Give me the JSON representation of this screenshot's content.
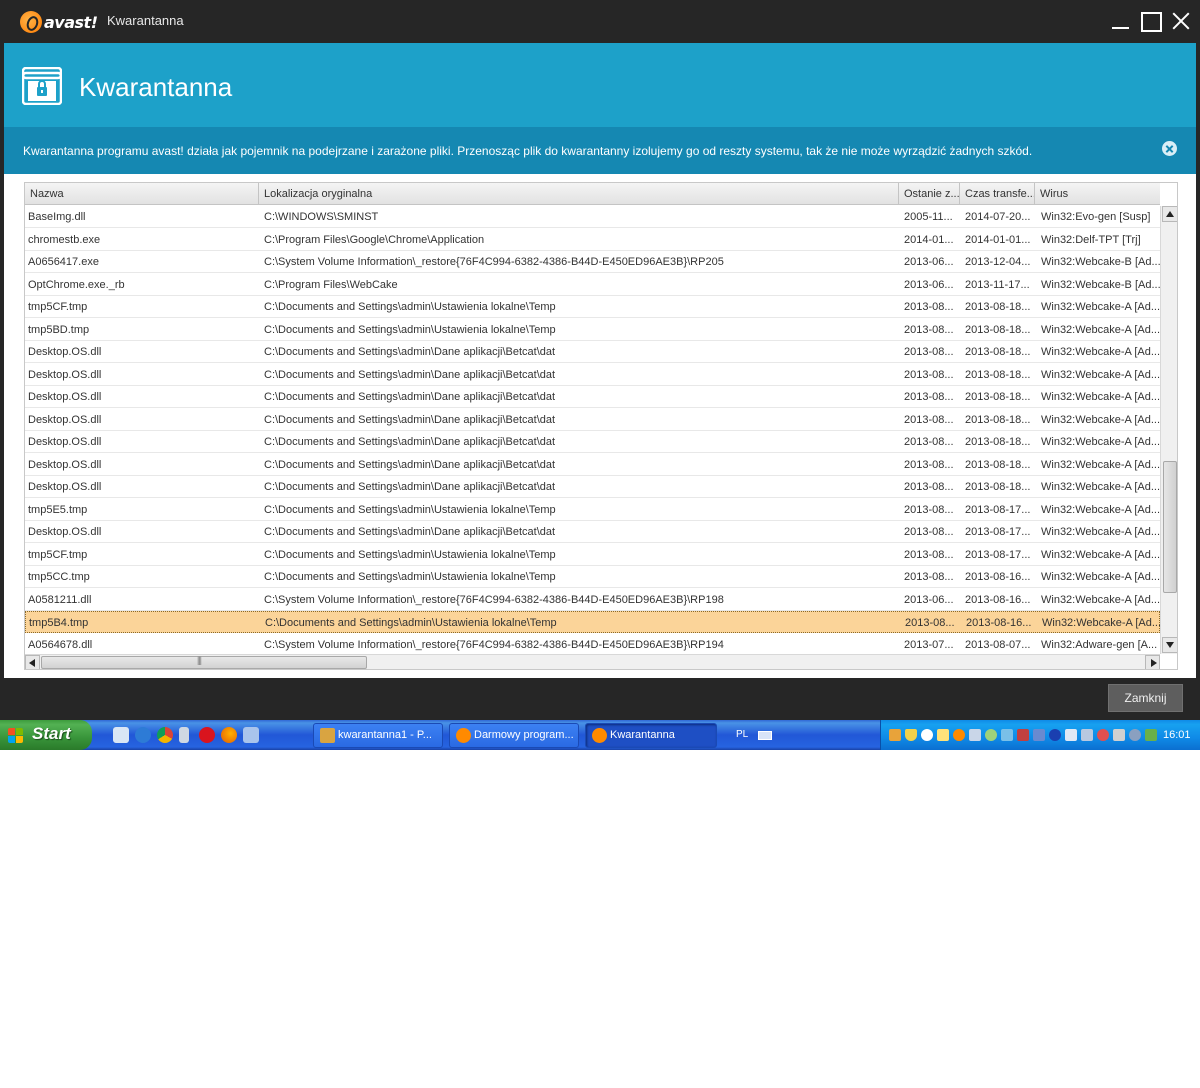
{
  "window": {
    "logo_text": "avast!",
    "title": "Kwarantanna"
  },
  "header": {
    "title": "Kwarantanna"
  },
  "info": {
    "text": "Kwarantanna programu avast! działa jak pojemnik na podejrzane i zarażone pliki. Przenosząc plik do kwarantanny izolujemy go od reszty systemu, tak że nie może wyrządzić żadnych szkód."
  },
  "table": {
    "columns": [
      "Nazwa",
      "Lokalizacja oryginalna",
      "Ostanie z...",
      "Czas transfe...",
      "Wirus"
    ],
    "rows": [
      [
        "BaseImg.dll",
        "C:\\WINDOWS\\SMINST",
        "2005-11...",
        "2014-07-20...",
        "Win32:Evo-gen [Susp]"
      ],
      [
        "chromestb.exe",
        "C:\\Program Files\\Google\\Chrome\\Application",
        "2014-01...",
        "2014-01-01...",
        "Win32:Delf-TPT [Trj]"
      ],
      [
        "A0656417.exe",
        "C:\\System Volume Information\\_restore{76F4C994-6382-4386-B44D-E450ED96AE3B}\\RP205",
        "2013-06...",
        "2013-12-04...",
        "Win32:Webcake-B [Ad..."
      ],
      [
        "OptChrome.exe._rb",
        "C:\\Program Files\\WebCake",
        "2013-06...",
        "2013-11-17...",
        "Win32:Webcake-B [Ad..."
      ],
      [
        "tmp5CF.tmp",
        "C:\\Documents and Settings\\admin\\Ustawienia lokalne\\Temp",
        "2013-08...",
        "2013-08-18...",
        "Win32:Webcake-A [Ad..."
      ],
      [
        "tmp5BD.tmp",
        "C:\\Documents and Settings\\admin\\Ustawienia lokalne\\Temp",
        "2013-08...",
        "2013-08-18...",
        "Win32:Webcake-A [Ad..."
      ],
      [
        "Desktop.OS.dll",
        "C:\\Documents and Settings\\admin\\Dane aplikacji\\Betcat\\dat",
        "2013-08...",
        "2013-08-18...",
        "Win32:Webcake-A [Ad..."
      ],
      [
        "Desktop.OS.dll",
        "C:\\Documents and Settings\\admin\\Dane aplikacji\\Betcat\\dat",
        "2013-08...",
        "2013-08-18...",
        "Win32:Webcake-A [Ad..."
      ],
      [
        "Desktop.OS.dll",
        "C:\\Documents and Settings\\admin\\Dane aplikacji\\Betcat\\dat",
        "2013-08...",
        "2013-08-18...",
        "Win32:Webcake-A [Ad..."
      ],
      [
        "Desktop.OS.dll",
        "C:\\Documents and Settings\\admin\\Dane aplikacji\\Betcat\\dat",
        "2013-08...",
        "2013-08-18...",
        "Win32:Webcake-A [Ad..."
      ],
      [
        "Desktop.OS.dll",
        "C:\\Documents and Settings\\admin\\Dane aplikacji\\Betcat\\dat",
        "2013-08...",
        "2013-08-18...",
        "Win32:Webcake-A [Ad..."
      ],
      [
        "Desktop.OS.dll",
        "C:\\Documents and Settings\\admin\\Dane aplikacji\\Betcat\\dat",
        "2013-08...",
        "2013-08-18...",
        "Win32:Webcake-A [Ad..."
      ],
      [
        "Desktop.OS.dll",
        "C:\\Documents and Settings\\admin\\Dane aplikacji\\Betcat\\dat",
        "2013-08...",
        "2013-08-18...",
        "Win32:Webcake-A [Ad..."
      ],
      [
        "tmp5E5.tmp",
        "C:\\Documents and Settings\\admin\\Ustawienia lokalne\\Temp",
        "2013-08...",
        "2013-08-17...",
        "Win32:Webcake-A [Ad..."
      ],
      [
        "Desktop.OS.dll",
        "C:\\Documents and Settings\\admin\\Dane aplikacji\\Betcat\\dat",
        "2013-08...",
        "2013-08-17...",
        "Win32:Webcake-A [Ad..."
      ],
      [
        "tmp5CF.tmp",
        "C:\\Documents and Settings\\admin\\Ustawienia lokalne\\Temp",
        "2013-08...",
        "2013-08-17...",
        "Win32:Webcake-A [Ad..."
      ],
      [
        "tmp5CC.tmp",
        "C:\\Documents and Settings\\admin\\Ustawienia lokalne\\Temp",
        "2013-08...",
        "2013-08-16...",
        "Win32:Webcake-A [Ad..."
      ],
      [
        "A0581211.dll",
        "C:\\System Volume Information\\_restore{76F4C994-6382-4386-B44D-E450ED96AE3B}\\RP198",
        "2013-06...",
        "2013-08-16...",
        "Win32:Webcake-A [Ad..."
      ],
      [
        "tmp5B4.tmp",
        "C:\\Documents and Settings\\admin\\Ustawienia lokalne\\Temp",
        "2013-08...",
        "2013-08-16...",
        "Win32:Webcake-A [Ad..."
      ],
      [
        "A0564678.dll",
        "C:\\System Volume Information\\_restore{76F4C994-6382-4386-B44D-E450ED96AE3B}\\RP194",
        "2013-07...",
        "2013-08-07...",
        "Win32:Adware-gen [A..."
      ]
    ],
    "selected_row_index": 18
  },
  "buttons": {
    "close_label": "Zamknij"
  },
  "taskbar": {
    "start_label": "Start",
    "tasks": [
      {
        "label": "kwarantanna1 - P...",
        "icon": "paint-icon",
        "color": "#d9a441"
      },
      {
        "label": "Darmowy program...",
        "icon": "avast-icon",
        "color": "#ff8a00"
      },
      {
        "label": "Kwarantanna",
        "icon": "avast-icon",
        "color": "#ff8a00"
      }
    ],
    "active_task_index": 2,
    "language": "PL",
    "clock": "16:01"
  },
  "colors": {
    "header_blue": "#1da1c9",
    "info_blue": "#1588b2",
    "selected_row": "#fbd499",
    "window_dark": "#262626",
    "avast_orange": "#ff7a00"
  }
}
